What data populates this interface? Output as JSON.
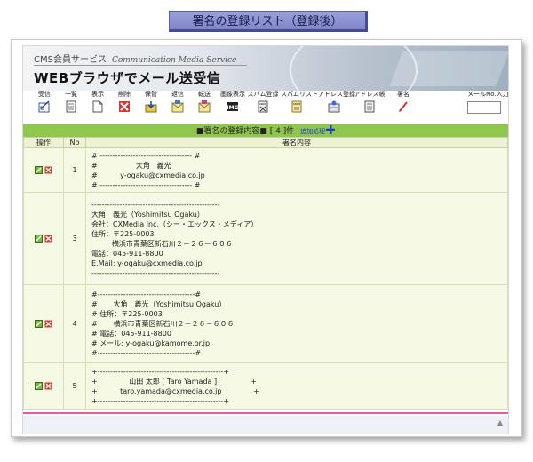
{
  "page_title": "署名の登録リスト（登録後）",
  "header": {
    "service_jp": "CMS会員サービス",
    "service_en": "Communication Media Service",
    "main_title": "WEBブラウザでメール送受信"
  },
  "toolbar": {
    "items": [
      {
        "label": "受信",
        "icon": "receive-icon"
      },
      {
        "label": "一覧",
        "icon": "list-icon"
      },
      {
        "label": "表示",
        "icon": "display-icon"
      },
      {
        "label": "削除",
        "icon": "delete-icon"
      },
      {
        "label": "保管",
        "icon": "save-icon"
      },
      {
        "label": "返信",
        "icon": "reply-icon"
      },
      {
        "label": "転送",
        "icon": "forward-icon"
      },
      {
        "label": "画像表示",
        "icon": "image-display-icon"
      },
      {
        "label": "スパム登録",
        "icon": "spam-register-icon"
      },
      {
        "label": "スパムリスト",
        "icon": "spam-list-icon"
      },
      {
        "label": "アドレス登録",
        "icon": "address-register-icon"
      },
      {
        "label": "アドレス帳",
        "icon": "address-book-icon"
      },
      {
        "label": "署名",
        "icon": "signature-icon"
      },
      {
        "label": "メールNo.入力",
        "icon": "mail-number-input"
      }
    ],
    "mail_no_value": ""
  },
  "list_header": {
    "prefix": "■署名の登録内容■ [ ",
    "count": "4",
    "suffix": " ]件",
    "add_label": "追加処理"
  },
  "columns": {
    "ops": "操作",
    "no": "No",
    "content": "署名内容"
  },
  "rows": [
    {
      "no": "1",
      "signature": "# ------------------------------------ #\n#                 大角   義光\n#          y-ogaku@cxmedia.co.jp\n# ------------------------------------ #"
    },
    {
      "no": "3",
      "signature": "--------------------------------------------------\n大角　義光（Yoshimitsu Ogaku）\n会社：CXMedia Inc.（シー・エックス・メディア）\n住所：〒225-0003\n         横浜市青葉区新石川２－２６－６０６\n電話：045-911-8800\nE.Mail: y-ogaku@cxmedia.co.jp\n--------------------------------------------------"
    },
    {
      "no": "4",
      "signature": "#--------------------------------------#\n#       大角　義光（Yoshimitsu Ogaku）\n# 住所：〒225-0003\n#       横浜市青葉区新石川２－２６－６０６\n# 電話：045-911-8800\n# メール: y-ogaku@kamome.or.jp\n#--------------------------------------#"
    },
    {
      "no": "5",
      "signature": "+-------------------------------------------------+\n+              山田 太郎 [ Taro Yamada ]               +\n+          taro.yamada@cxmedia.co.jp              +\n+-------------------------------------------------+"
    }
  ],
  "colors": {
    "accent_green": "#8ec64e",
    "footer_pink": "#e85aa6",
    "title_badge": "#8a90d2"
  }
}
